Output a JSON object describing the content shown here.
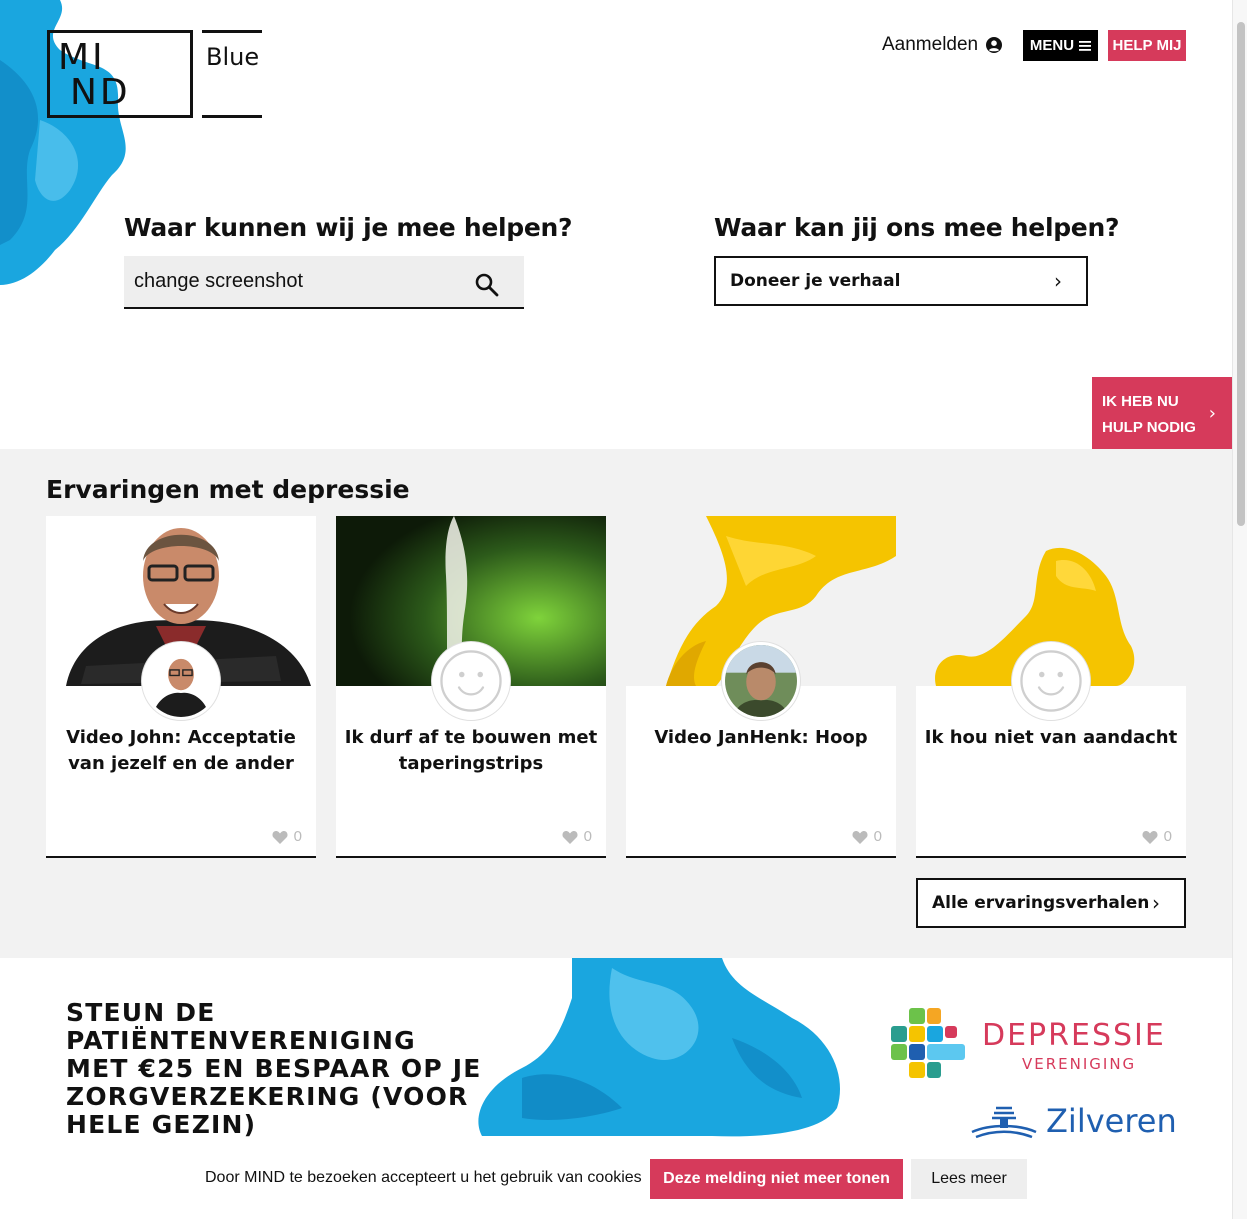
{
  "logo": {
    "mind_line1": "MI",
    "mind_line2": "ND",
    "blue": "Blue"
  },
  "header": {
    "login_label": "Aanmelden",
    "menu_label": "MENU",
    "help_label": "HELP MIJ"
  },
  "help_section": {
    "left_heading": "Waar kunnen wij je mee helpen?",
    "search_value": "change screenshot",
    "right_heading": "Waar kan jij ons mee helpen?",
    "donate_label": "Doneer je verhaal"
  },
  "side_tab": {
    "line1": "IK HEB NU",
    "line2": "HULP NODIG"
  },
  "experiences": {
    "heading": "Ervaringen met depressie",
    "cards": [
      {
        "title": "Video John: Acceptatie van jezelf en de ander",
        "likes": "0"
      },
      {
        "title": "Ik durf af te bouwen met taperingstrips",
        "likes": "0"
      },
      {
        "title": "Video JanHenk: Hoop",
        "likes": "0"
      },
      {
        "title": "Ik hou niet van aandacht",
        "likes": "0"
      }
    ],
    "all_label": "Alle ervaringsverhalen"
  },
  "banner": {
    "text": "STEUN DE PATIËNTENVERENIGING MET €25 EN BESPAAR OP JE ZORGVERZEKERING (VOOR HELE GEZIN)",
    "partner1_name": "DEPRESSIE",
    "partner1_sub": "VERENIGING",
    "partner2_name": "Zilveren"
  },
  "cookie": {
    "text": "Door MIND te bezoeken accepteert u het gebruik van cookies",
    "accept_label": "Deze melding niet meer tonen",
    "more_label": "Lees meer"
  },
  "colors": {
    "accent": "#d63a5b",
    "ink_blue": "#1aa6df",
    "ink_yellow": "#f5c400",
    "grey_bg": "#f2f2f2"
  }
}
